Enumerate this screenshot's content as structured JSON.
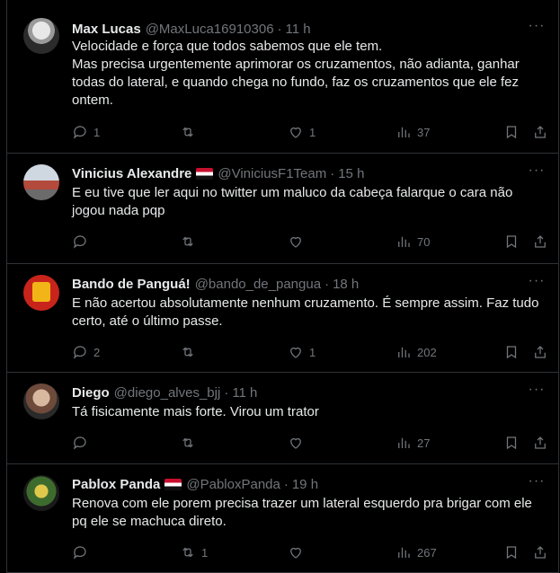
{
  "more_label": "···",
  "separator": "·",
  "tweets": [
    {
      "name": "Max Lucas",
      "handle": "@MaxLuca16910306",
      "time": "11 h",
      "has_flag": false,
      "text": "Velocidade e força que todos sabemos que ele tem.\nMas precisa urgentemente aprimorar os cruzamentos, não adianta, ganhar todas do lateral, e quando chega no fundo, faz os cruzamentos que ele fez ontem.",
      "replies": "1",
      "retweets": "",
      "likes": "1",
      "views": "37"
    },
    {
      "name": "Vinicius Alexandre",
      "handle": "@ViniciusF1Team",
      "time": "15 h",
      "has_flag": true,
      "text": "E eu tive que ler aqui no twitter um maluco da cabeça falarque o cara não jogou nada pqp",
      "replies": "",
      "retweets": "",
      "likes": "",
      "views": "70"
    },
    {
      "name": "Bando de Panguá!",
      "handle": "@bando_de_pangua",
      "time": "18 h",
      "has_flag": false,
      "text": "E não acertou absolutamente nenhum cruzamento.  É sempre assim. Faz tudo certo, até o último passe.",
      "replies": "2",
      "retweets": "",
      "likes": "1",
      "views": "202"
    },
    {
      "name": "Diego",
      "handle": "@diego_alves_bjj",
      "time": "11 h",
      "has_flag": false,
      "text": "Tá fisicamente mais forte. Virou um trator",
      "replies": "",
      "retweets": "",
      "likes": "",
      "views": "27"
    },
    {
      "name": "Pablox Panda",
      "handle": "@PabloxPanda",
      "time": "19 h",
      "has_flag": true,
      "text": "Renova com ele porem precisa trazer um lateral esquerdo pra brigar com ele pq ele se machuca direto.",
      "replies": "",
      "retweets": "1",
      "likes": "",
      "views": "267"
    }
  ]
}
